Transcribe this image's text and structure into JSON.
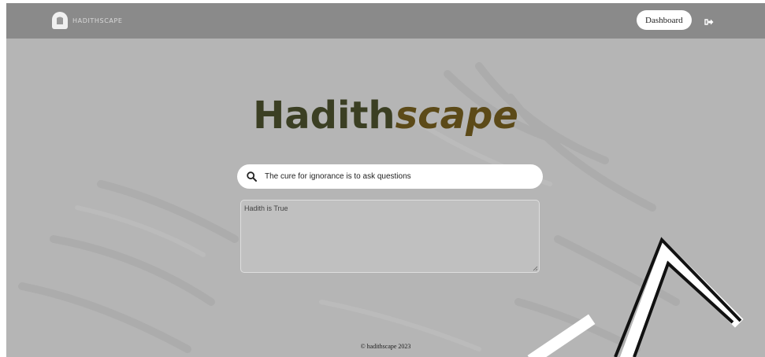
{
  "header": {
    "brand_text": "HADITHSCAPE",
    "dashboard_label": "Dashboard",
    "logout_icon": "sign-out-icon"
  },
  "hero": {
    "title_part1": "Hadith",
    "title_part2": "scape"
  },
  "search": {
    "value": "The cure for ignorance is to ask questions",
    "icon": "search-icon"
  },
  "result": {
    "value": "Hadith is True"
  },
  "footer": {
    "text": "© hadithscape 2023"
  },
  "colors": {
    "topbar": "#8a8a8a",
    "page_background": "#b5b5b5",
    "title_dark": "#3b3f23",
    "title_accent": "#5c4a18"
  }
}
